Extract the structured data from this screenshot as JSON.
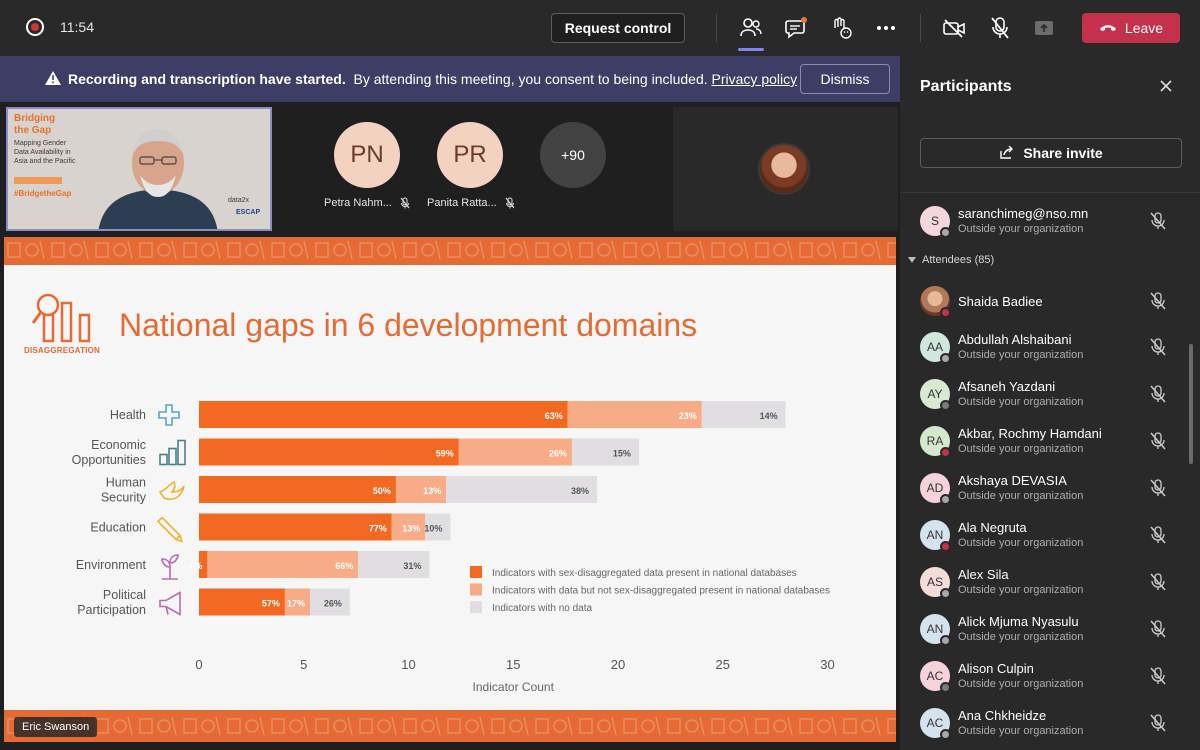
{
  "topbar": {
    "time": "11:54",
    "request_control_label": "Request control",
    "leave_label": "Leave"
  },
  "banner": {
    "bold_text": "Recording and transcription have started.",
    "text": "By attending this meeting, you consent to being included.",
    "link_text": "Privacy policy",
    "dismiss_label": "Dismiss"
  },
  "video_strip": {
    "self_slide": {
      "title_line1": "Bridging",
      "title_line2": "the Gap",
      "subtitle_lines": [
        "Mapping Gender",
        "Data Availability in",
        "Asia and the Pacific"
      ],
      "hashtag": "#BridgetheGap",
      "logo1": "data2x",
      "logo2": "ESCAP"
    },
    "participants": [
      {
        "initials": "PN",
        "name": "Petra Nahm..."
      },
      {
        "initials": "PR",
        "name": "Panita Ratta..."
      }
    ],
    "more_count": "+90"
  },
  "slide": {
    "title": "National gaps in 6 development domains",
    "icon_label": "DISAGGREGATION",
    "speaker": "Eric Swanson"
  },
  "chart_data": {
    "type": "bar",
    "stacked": true,
    "orientation": "horizontal",
    "xlabel": "Indicator Count",
    "xlim": [
      0,
      30
    ],
    "xticks": [
      0,
      5,
      10,
      15,
      20,
      25,
      30
    ],
    "categories": [
      {
        "label": "Health",
        "icon": "cross-icon"
      },
      {
        "label": "Economic\nOpportunities",
        "icon": "coins-icon"
      },
      {
        "label": "Human\nSecurity",
        "icon": "dove-icon"
      },
      {
        "label": "Education",
        "icon": "pencil-icon"
      },
      {
        "label": "Environment",
        "icon": "plant-icon"
      },
      {
        "label": "Political\nParticipation",
        "icon": "megaphone-icon"
      }
    ],
    "series": [
      {
        "name": "Indicators with sex-disaggregated data present in national databases",
        "color": "#f26a21",
        "values": [
          17.6,
          12.4,
          9.4,
          9.2,
          0.4,
          4.1
        ],
        "labels": [
          "63%",
          "59%",
          "50%",
          "77%",
          "4%",
          "57%"
        ]
      },
      {
        "name": "Indicators with data but not sex-disaggregated present in national databases",
        "color": "#f7ab86",
        "values": [
          6.4,
          5.4,
          2.4,
          1.6,
          7.2,
          1.2
        ],
        "labels": [
          "23%",
          "26%",
          "13%",
          "13%",
          "66%",
          "17%"
        ]
      },
      {
        "name": "Indicators with no data",
        "color": "#e0dee1",
        "values": [
          4.0,
          3.2,
          7.2,
          1.2,
          3.4,
          1.9
        ],
        "labels": [
          "14%",
          "15%",
          "38%",
          "10%",
          "31%",
          "26%"
        ]
      }
    ],
    "legend_position": "right",
    "grid": false
  },
  "panel": {
    "title": "Participants",
    "share_invite_label": "Share invite",
    "section_label": "Attendees (85)",
    "people": [
      {
        "initials": "S",
        "name": "saranchimeg@nso.mn",
        "sub": "Outside your organization",
        "avatar_color": "#f3d7dc",
        "status": "#a8a8a8",
        "photo": false
      },
      {
        "initials": "",
        "name": "Shaida Badiee",
        "sub": "",
        "avatar_color": "#b07a5a",
        "status": "#c4314b",
        "photo": true
      },
      {
        "initials": "AA",
        "name": "Abdullah Alshaibani",
        "sub": "Outside your organization",
        "avatar_color": "#cfe7dc",
        "status": "#a8a8a8",
        "photo": false
      },
      {
        "initials": "AY",
        "name": "Afsaneh Yazdani",
        "sub": "Outside your organization",
        "avatar_color": "#d9ead3",
        "status": "#7a7a7a",
        "photo": false
      },
      {
        "initials": "RA",
        "name": "Akbar, Rochmy Hamdani",
        "sub": "Outside your organization",
        "avatar_color": "#d6e8cc",
        "status": "#c4314b",
        "photo": false
      },
      {
        "initials": "AD",
        "name": "Akshaya DEVASIA",
        "sub": "Outside your organization",
        "avatar_color": "#f6d3dc",
        "status": "#a8a8a8",
        "photo": false
      },
      {
        "initials": "AN",
        "name": "Ala Negruta",
        "sub": "Outside your organization",
        "avatar_color": "#d5e3ef",
        "status": "#c4314b",
        "photo": false
      },
      {
        "initials": "AS",
        "name": "Alex Sila",
        "sub": "Outside your organization",
        "avatar_color": "#f4dcd8",
        "status": "#a8a8a8",
        "photo": false
      },
      {
        "initials": "AN",
        "name": "Alick Mjuma Nyasulu",
        "sub": "Outside your organization",
        "avatar_color": "#d5e3ef",
        "status": "#a8a8a8",
        "photo": false
      },
      {
        "initials": "AC",
        "name": "Alison Culpin",
        "sub": "Outside your organization",
        "avatar_color": "#f6d3dc",
        "status": "#7a7a7a",
        "photo": false
      },
      {
        "initials": "AC",
        "name": "Ana Chkheidze",
        "sub": "Outside your organization",
        "avatar_color": "#d5e3ef",
        "status": "#a8a8a8",
        "photo": false
      }
    ]
  }
}
